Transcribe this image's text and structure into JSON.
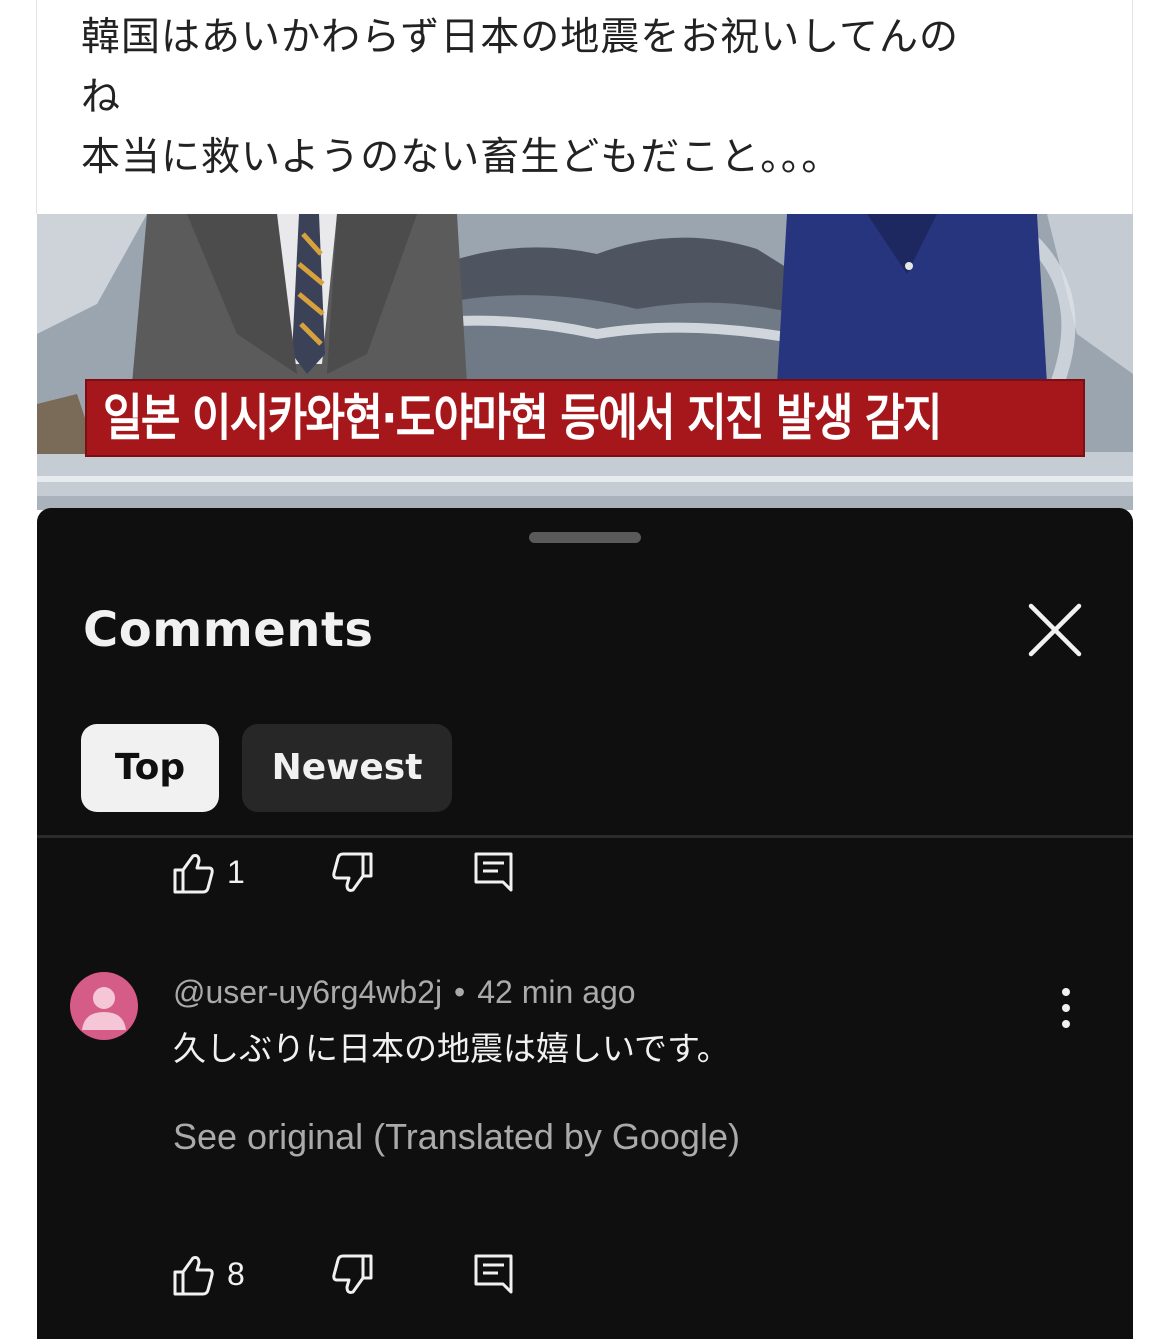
{
  "post": {
    "lines": [
      "韓国はあいかわらず日本の地震をお祝いしてんの",
      "ね",
      "本当に救いようのない畜生どもだこと。。。"
    ]
  },
  "news_image": {
    "chyron": "일본 이시카와현·도야마현 등에서 지진 발생 감지"
  },
  "comments_sheet": {
    "title": "Comments",
    "close_icon": "close-icon",
    "chips": [
      "Top",
      "Newest"
    ],
    "selected_chip": "Top",
    "previous_comment_actions": {
      "like_count": "1"
    },
    "comment": {
      "author": "@user-uy6rg4wb2j",
      "separator": "•",
      "time": "42 min ago",
      "text": "久しぶりに日本の地震は嬉しいです。",
      "see_original": "See original (Translated by Google)",
      "like_count": "8",
      "avatar_color": "#d55c87"
    }
  },
  "colors": {
    "sheet_bg": "#0f0f0f",
    "chip_selected_bg": "#f1f1f1",
    "chip_bg": "#272727",
    "chyron_red": "#a5171a",
    "secondary_text": "#aaaaaa"
  }
}
